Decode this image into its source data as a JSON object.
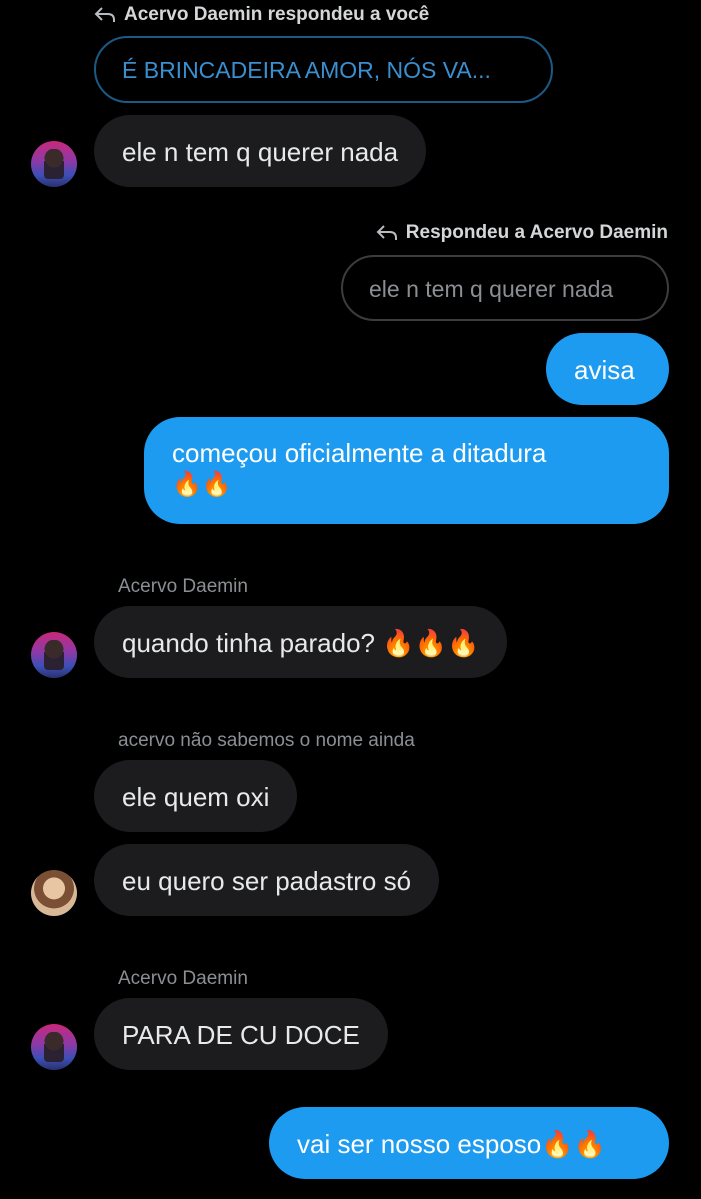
{
  "reply1": {
    "header": "Acervo Daemin respondeu a você",
    "quote": "É BRINCADEIRA AMOR, NÓS VA..."
  },
  "msg1": {
    "text": "ele n tem q querer nada"
  },
  "reply2": {
    "header": "Respondeu a Acervo Daemin",
    "quote": "ele n tem q querer nada"
  },
  "msg2": {
    "text": "avisa"
  },
  "msg3": {
    "line1": "começou oficialmente a ditadura",
    "line2": "🔥🔥"
  },
  "sender1": "Acervo Daemin",
  "msg4": {
    "text": "quando tinha parado? 🔥🔥🔥"
  },
  "sender2": "acervo não sabemos o nome ainda",
  "msg5": {
    "text": "ele quem oxi"
  },
  "msg6": {
    "text": "eu quero ser padastro só"
  },
  "sender3": "Acervo Daemin",
  "msg7": {
    "text": "PARA DE CU DOCE"
  },
  "msg8": {
    "text": "vai ser nosso esposo🔥🔥"
  },
  "colors": {
    "outgoing": "#1d9bf0",
    "incoming": "#1c1c1e",
    "background": "#000000"
  },
  "icons": {
    "reply": "reply-arrow-icon"
  }
}
